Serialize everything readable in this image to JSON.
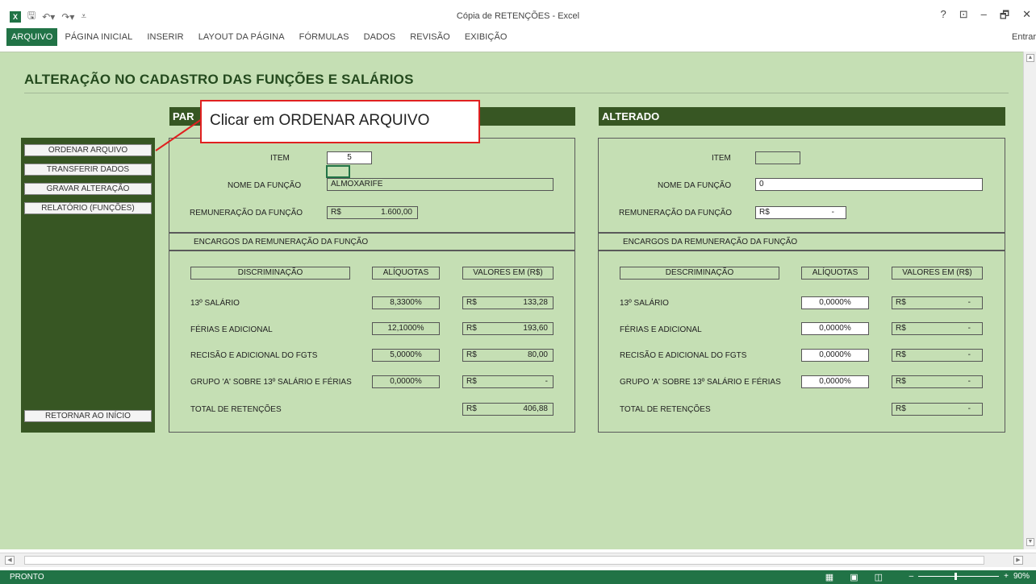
{
  "window": {
    "title": "Cópia de RETENÇÕES - Excel",
    "controls": [
      "?",
      "⊡",
      "–",
      "🗗",
      "✕"
    ]
  },
  "ribbon": {
    "tabs": [
      "ARQUIVO",
      "PÁGINA INICIAL",
      "INSERIR",
      "LAYOUT DA PÁGINA",
      "FÓRMULAS",
      "DADOS",
      "REVISÃO",
      "EXIBIÇÃO"
    ],
    "signin": "Entrar"
  },
  "sheet": {
    "title": "ALTERAÇÃO NO CADASTRO DAS FUNÇÕES E SALÁRIOS",
    "sidebar_buttons": [
      "ORDENAR ARQUIVO",
      "TRANSFERIR DADOS",
      "GRAVAR ALTERAÇÃO",
      "RELATÓRIO (FUNÇÕES)"
    ],
    "return_button": "RETORNAR AO INÍCIO",
    "callout": "Clicar em ORDENAR ARQUIVO",
    "left": {
      "header": "PAR",
      "item_label": "ITEM",
      "item_value": "5",
      "nome_label": "NOME DA FUNÇÃO",
      "nome_value": "ALMOXARIFE",
      "remun_label": "REMUNERAÇÃO DA FUNÇÃO",
      "remun_currency": "R$",
      "remun_value": "1.600,00",
      "encargos_label": "ENCARGOS DA REMUNERAÇÃO DA FUNÇÃO",
      "col_disc": "DISCRIMINAÇÃO",
      "col_aliq": "ALÍQUOTAS",
      "col_val": "VALORES EM (R$)",
      "rows": [
        {
          "label": "13º SALÁRIO",
          "aliq": "8,3300%",
          "cur": "R$",
          "val": "133,28"
        },
        {
          "label": "FÉRIAS E ADICIONAL",
          "aliq": "12,1000%",
          "cur": "R$",
          "val": "193,60"
        },
        {
          "label": "RECISÃO E ADICIONAL DO FGTS",
          "aliq": "5,0000%",
          "cur": "R$",
          "val": "80,00"
        },
        {
          "label": "GRUPO 'A' SOBRE 13º SALÁRIO E FÉRIAS",
          "aliq": "0,0000%",
          "cur": "R$",
          "val": "-"
        }
      ],
      "total_label": "TOTAL DE RETENÇÕES",
      "total_cur": "R$",
      "total_val": "406,88"
    },
    "right": {
      "header": "ALTERADO",
      "item_label": "ITEM",
      "item_value": "",
      "nome_label": "NOME DA FUNÇÃO",
      "nome_value": "0",
      "remun_label": "REMUNERAÇÃO DA FUNÇÃO",
      "remun_currency": "R$",
      "remun_value": "-",
      "encargos_label": "ENCARGOS DA REMUNERAÇÃO DA FUNÇÃO",
      "col_disc": "DESCRIMINAÇÃO",
      "col_aliq": "ALÍQUOTAS",
      "col_val": "VALORES EM (R$)",
      "rows": [
        {
          "label": "13º SALÁRIO",
          "aliq": "0,0000%",
          "cur": "R$",
          "val": "-"
        },
        {
          "label": "FÉRIAS E ADICIONAL",
          "aliq": "0,0000%",
          "cur": "R$",
          "val": "-"
        },
        {
          "label": "RECISÃO E ADICIONAL DO FGTS",
          "aliq": "0,0000%",
          "cur": "R$",
          "val": "-"
        },
        {
          "label": "GRUPO 'A' SOBRE 13º SALÁRIO E FÉRIAS",
          "aliq": "0,0000%",
          "cur": "R$",
          "val": "-"
        }
      ],
      "total_label": "TOTAL DE RETENÇÕES",
      "total_cur": "R$",
      "total_val": "-"
    }
  },
  "statusbar": {
    "status": "PRONTO",
    "zoom": "90%"
  },
  "colors": {
    "excel_green": "#217346",
    "sheet_bg": "#c5dfb4",
    "header_green": "#375623",
    "callout_border": "#e02020"
  }
}
